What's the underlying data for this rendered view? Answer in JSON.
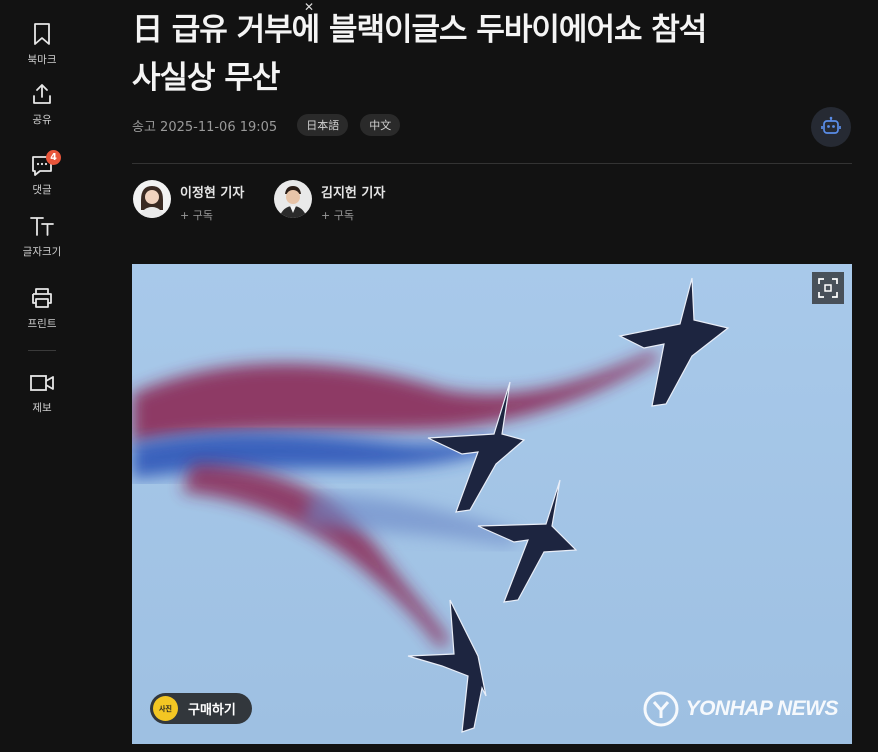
{
  "sidebar": {
    "items": [
      {
        "label": "북마크",
        "icon": "bookmark-icon"
      },
      {
        "label": "공유",
        "icon": "share-icon"
      },
      {
        "label": "댓글",
        "icon": "comment-icon",
        "badge": "4"
      },
      {
        "label": "글자크기",
        "icon": "text-size-icon"
      },
      {
        "label": "프린트",
        "icon": "print-icon"
      },
      {
        "label": "제보",
        "icon": "video-report-icon"
      }
    ]
  },
  "article": {
    "headline_line1": "日 급유 거부에 블랙이글스 두바이에어쇼 참석",
    "headline_line2": "사실상 무산",
    "sent_date": "송고 2025-11-06 19:05",
    "languages": [
      "日本語",
      "中文"
    ]
  },
  "reporters": [
    {
      "name": "이정현 기자",
      "subscribe": "+ 구독"
    },
    {
      "name": "김지헌 기자",
      "subscribe": "+ 구독"
    }
  ],
  "photo": {
    "buy_label": "구매하기",
    "buy_icon_text": "사진",
    "watermark": "YONHAP NEWS",
    "colors": {
      "sky": "#9ec3e6",
      "red_smoke": "#8a2350",
      "blue_smoke": "#2d57b8"
    }
  }
}
